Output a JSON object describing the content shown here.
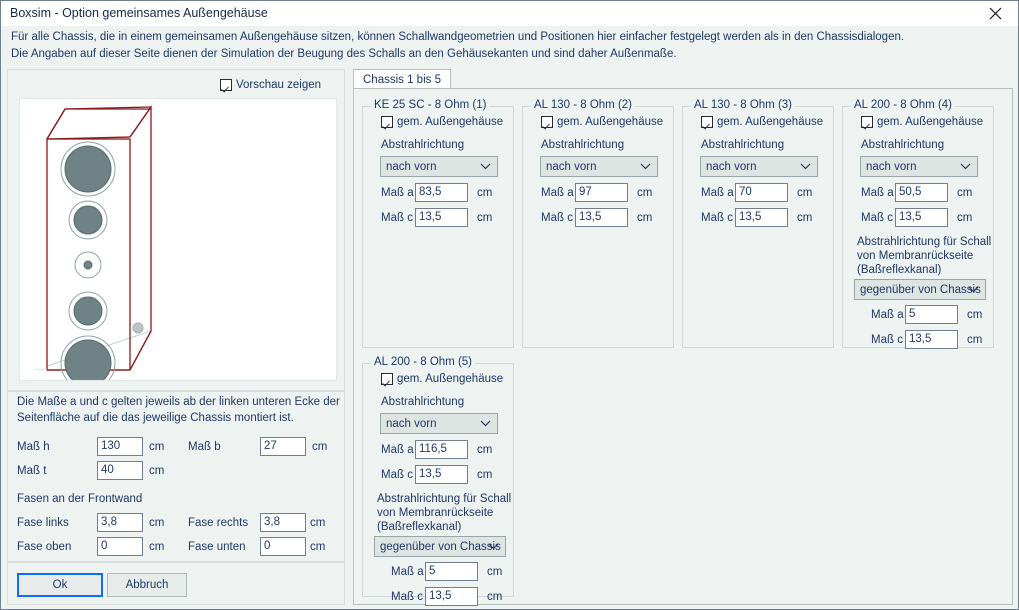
{
  "window": {
    "title": "Boxsim - Option gemeinsames Außengehäuse",
    "close_icon": "close-icon"
  },
  "intro": {
    "line1": "Für alle Chassis, die in einem gemeinsamen Außengehäuse sitzen, können Schallwandgeometrien und Positionen hier einfacher festgelegt werden als in den Chassisdialogen.",
    "line2": "Die Angaben auf dieser Seite dienen der Simulation der  Beugung des Schalls an den Gehäusekanten und sind daher Außenmaße."
  },
  "left_panel": {
    "preview_checkbox": {
      "label": "Vorschau zeigen",
      "checked": true
    }
  },
  "dims": {
    "hint_line1": "Die Maße a und c gelten jeweils ab der linken unteren Ecke der",
    "hint_line2": "Seitenfläche auf die das jeweilige Chassis montiert ist.",
    "mass_h_label": "Maß h",
    "mass_h_value": "130",
    "mass_b_label": "Maß b",
    "mass_b_value": "27",
    "mass_t_label": "Maß t",
    "mass_t_value": "40",
    "unit": "cm",
    "fasen_title": "Fasen an der Frontwand",
    "fase_links_label": "Fase links",
    "fase_links_value": "3,8",
    "fase_rechts_label": "Fase rechts",
    "fase_rechts_value": "3,8",
    "fase_oben_label": "Fase oben",
    "fase_oben_value": "0",
    "fase_unten_label": "Fase unten",
    "fase_unten_value": "0"
  },
  "buttons": {
    "ok": "Ok",
    "cancel": "Abbruch"
  },
  "tabs": {
    "tab1_label": "Chassis 1 bis 5"
  },
  "common": {
    "gem_label": "gem. Außengehäuse",
    "abstrahlrichtung_label": "Abstrahlrichtung",
    "rear_label_line1": "Abstrahlrichtung für Schall",
    "rear_label_line2": "von Membranrückseite",
    "rear_label_line3": "(Baßreflexkanal)",
    "mass_a_label": "Maß a",
    "mass_c_label": "Maß c",
    "unit": "cm",
    "direction_front": "nach vorn",
    "direction_opposite": "gegenüber von Chassis"
  },
  "chassis": [
    {
      "title": "KE 25 SC - 8 Ohm   (1)",
      "gem_checked": true,
      "direction": "nach vorn",
      "mass_a": "83,5",
      "mass_c": "13,5",
      "has_rear": false
    },
    {
      "title": "AL 130 - 8 Ohm (2)",
      "gem_checked": true,
      "direction": "nach vorn",
      "mass_a": "97",
      "mass_c": "13,5",
      "has_rear": false
    },
    {
      "title": "AL 130 - 8 Ohm (3)",
      "gem_checked": true,
      "direction": "nach vorn",
      "mass_a": "70",
      "mass_c": "13,5",
      "has_rear": false
    },
    {
      "title": "AL 200 - 8 Ohm (4)",
      "gem_checked": true,
      "direction": "nach vorn",
      "mass_a": "50,5",
      "mass_c": "13,5",
      "has_rear": true,
      "rear_direction": "gegenüber von Chassis",
      "rear_mass_a": "5",
      "rear_mass_c": "13,5"
    },
    {
      "title": "AL 200 - 8 Ohm (5)",
      "gem_checked": true,
      "direction": "nach vorn",
      "mass_a": "116,5",
      "mass_c": "13,5",
      "has_rear": true,
      "rear_direction": "gegenüber von Chassis",
      "rear_mass_a": "5",
      "rear_mass_c": "13,5"
    }
  ],
  "colors": {
    "dialog_bg": "#eef2f1",
    "text": "#1f3864",
    "cabinet_outline": "#8b1a1a",
    "driver_fill": "#6f8285",
    "combo_bg": "#dde4e2",
    "focus_blue": "#0d6efd"
  }
}
